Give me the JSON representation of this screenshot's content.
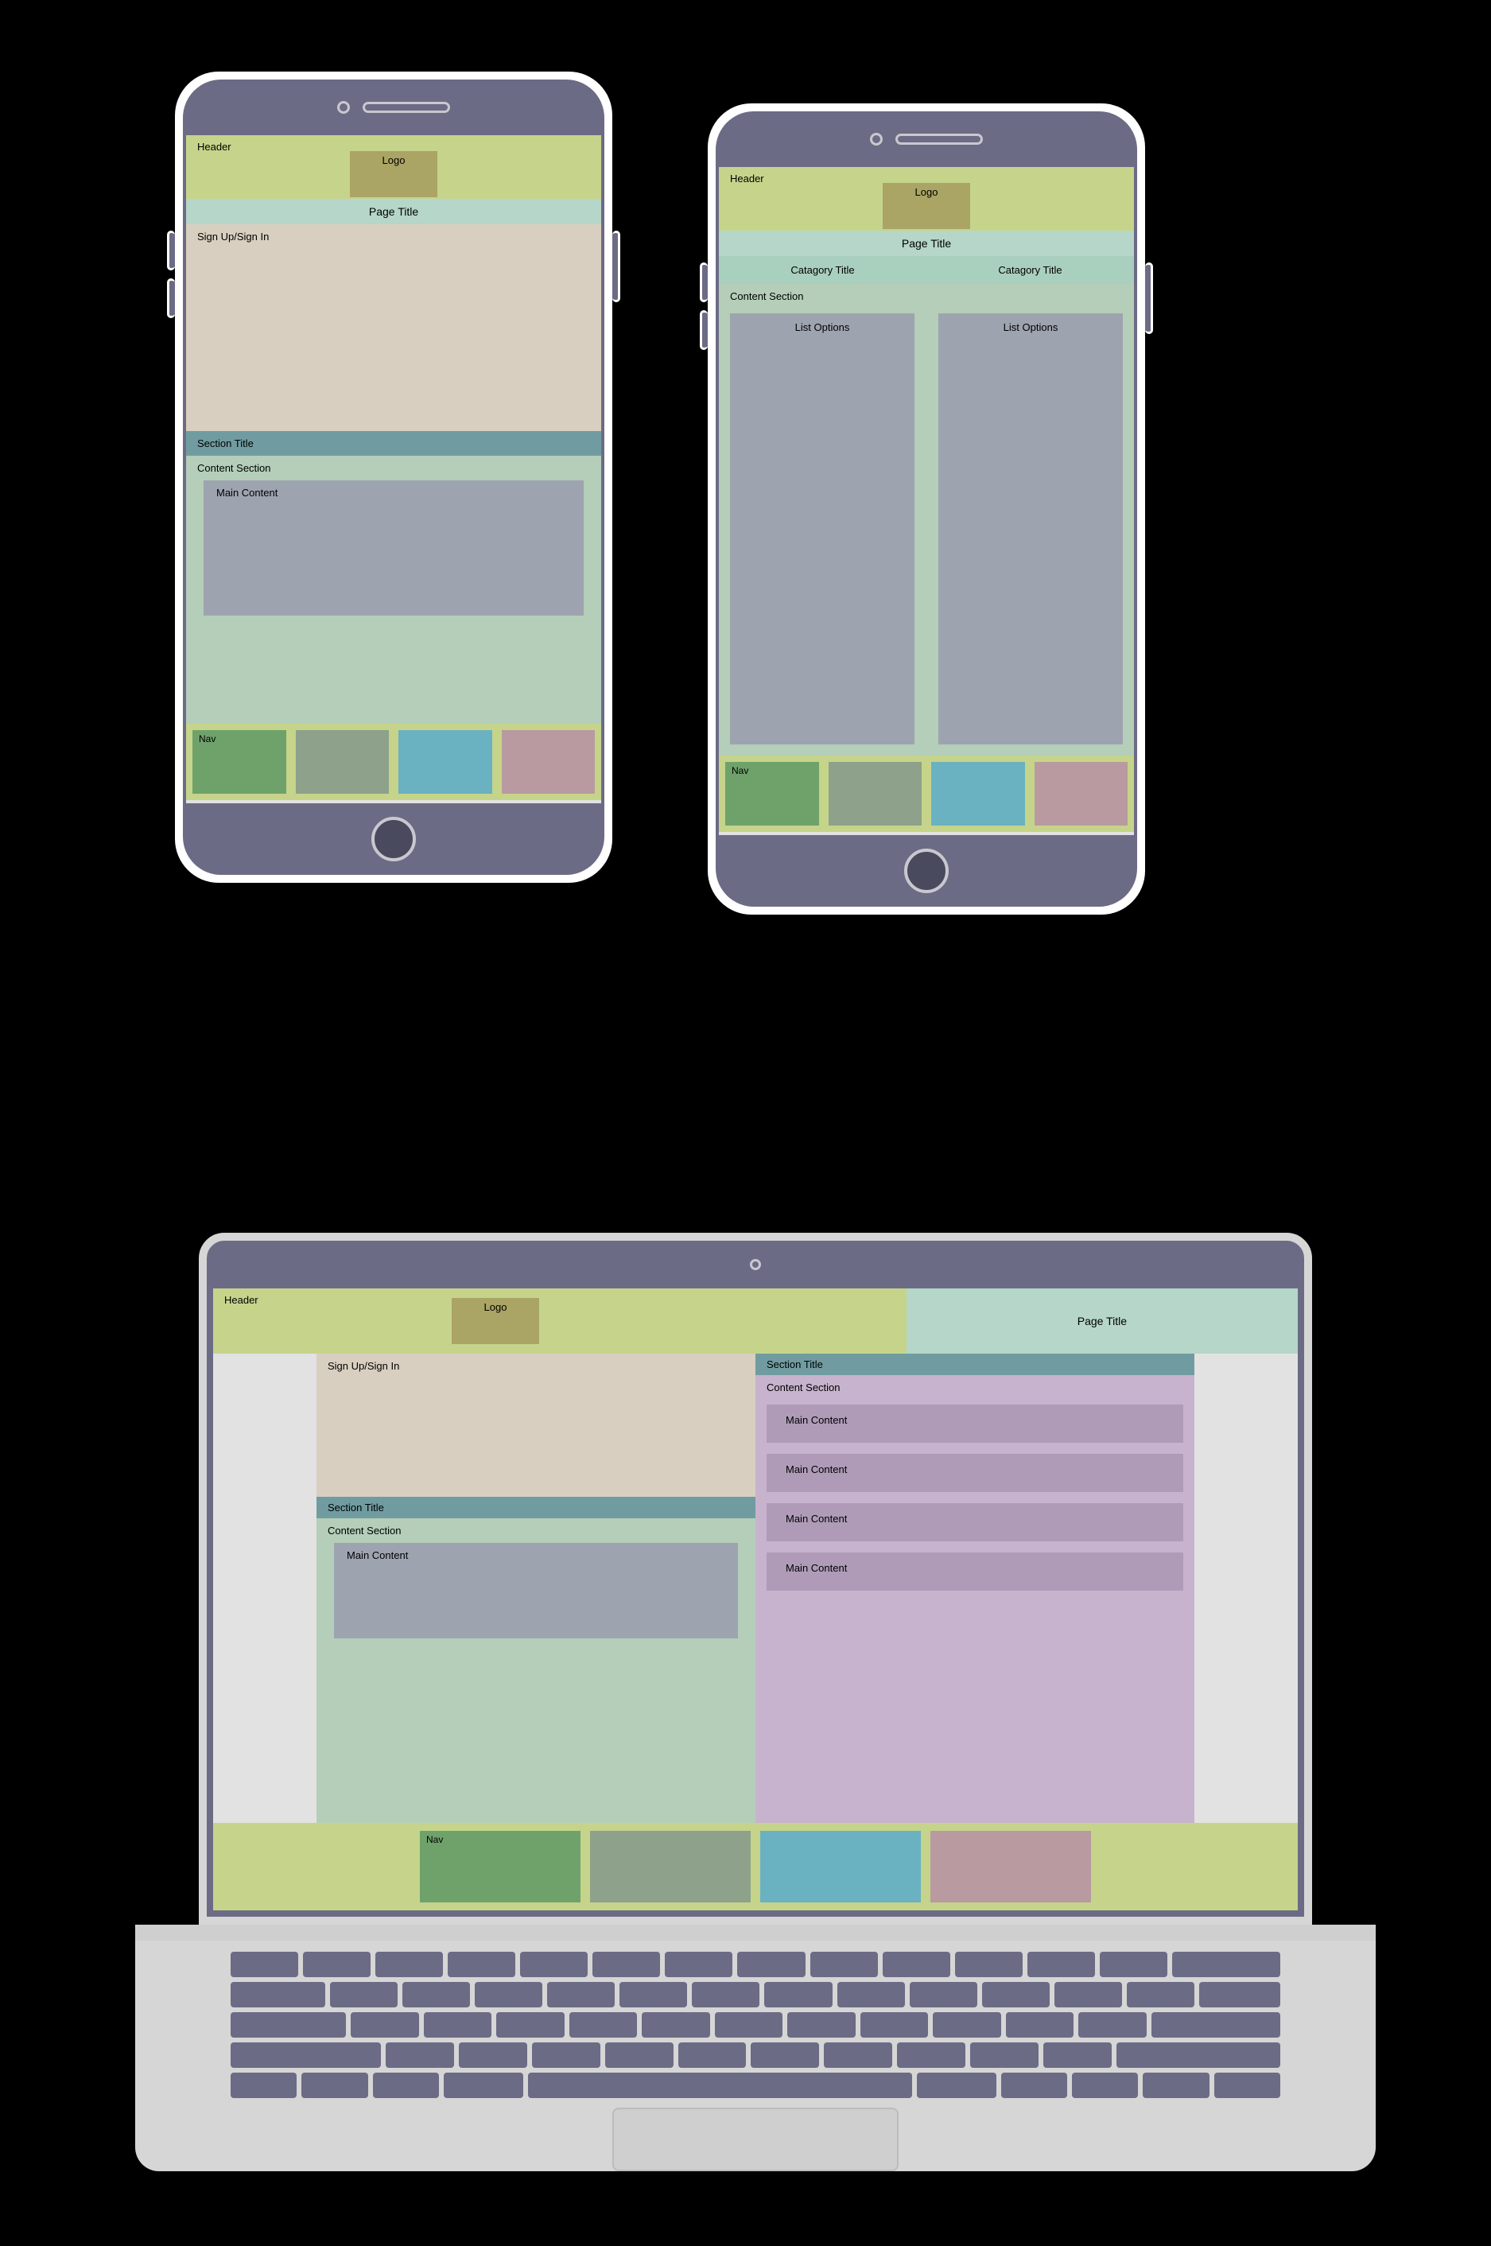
{
  "phone1": {
    "header": "Header",
    "logo": "Logo",
    "page_title": "Page Title",
    "signup": "Sign Up/Sign In",
    "section_title": "Section Title",
    "content_section": "Content Section",
    "main_content": "Main Content",
    "nav": "Nav"
  },
  "phone2": {
    "header": "Header",
    "logo": "Logo",
    "page_title": "Page Title",
    "category1": "Catagory Title",
    "category2": "Catagory Title",
    "content_section": "Content Section",
    "list1": "List Options",
    "list2": "List Options",
    "nav": "Nav"
  },
  "laptop": {
    "header": "Header",
    "logo": "Logo",
    "page_title": "Page Title",
    "signup": "Sign Up/Sign In",
    "section_title_left": "Section Title",
    "content_section_left": "Content Section",
    "main_content_left": "Main Content",
    "section_title_right": "Section Title",
    "content_section_right": "Content Section",
    "main_content_right": [
      "Main Content",
      "Main Content",
      "Main Content",
      "Main Content"
    ],
    "nav": "Nav"
  },
  "colors": {
    "header_bg": "#c5d48a",
    "logo_bg": "#aaa465",
    "title_bg": "#b5d6c8",
    "signup_bg": "#d8cfc0",
    "section_title_bg": "#709ca1",
    "content_green_bg": "#b4ceb9",
    "content_purple_bg": "#c7b3cd",
    "main_slate_bg": "#9ea3b0",
    "nav_colors": [
      "#6fa26b",
      "#8ea18a",
      "#6ab1c2",
      "#b99aa0"
    ],
    "device_body": "#6c6b85"
  }
}
